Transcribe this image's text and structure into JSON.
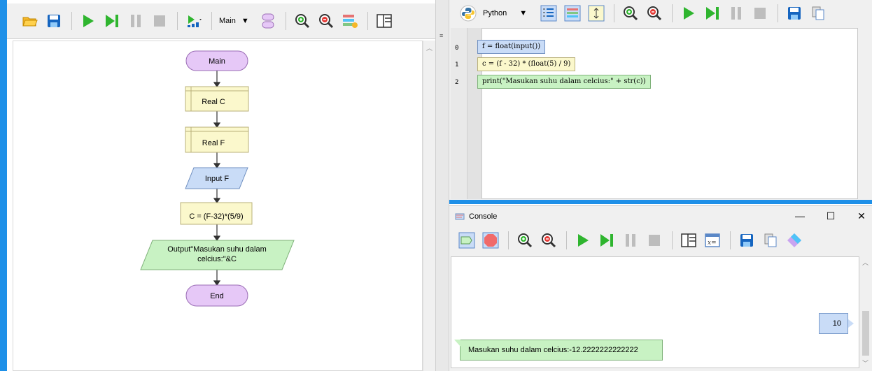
{
  "flowchart": {
    "toolbar": {
      "function_select": "Main"
    },
    "nodes": {
      "start": "Main",
      "declare_c": "Real C",
      "declare_f": "Real F",
      "input": "Input F",
      "assign": "C = (F-32)*(5/9)",
      "output_line1": "Output\"Masukan suhu dalam",
      "output_line2": "celcius:\"&C",
      "end": "End"
    }
  },
  "code": {
    "language": "Python",
    "lines": [
      {
        "num": "0",
        "text": "f = float(input())"
      },
      {
        "num": "1",
        "text": "c = (f - 32) * (float(5) / 9)"
      },
      {
        "num": "2",
        "text": "print(\"Masukan suhu dalam celcius:\" + str(c))"
      }
    ]
  },
  "console": {
    "title": "Console",
    "window_controls": {
      "minimize": "—",
      "maximize": "☐",
      "close": "✕"
    },
    "input_bubble": "10",
    "output_bubble": "Masukan suhu dalam celcius:-12.2222222222222"
  },
  "colors": {
    "accent": "#1e90e8",
    "terminal_fill": "#e6c8f7",
    "declare_fill": "#fbf8cc",
    "input_fill": "#c9dcf7",
    "process_fill": "#fbf8cc",
    "output_fill": "#c8f2c3"
  }
}
